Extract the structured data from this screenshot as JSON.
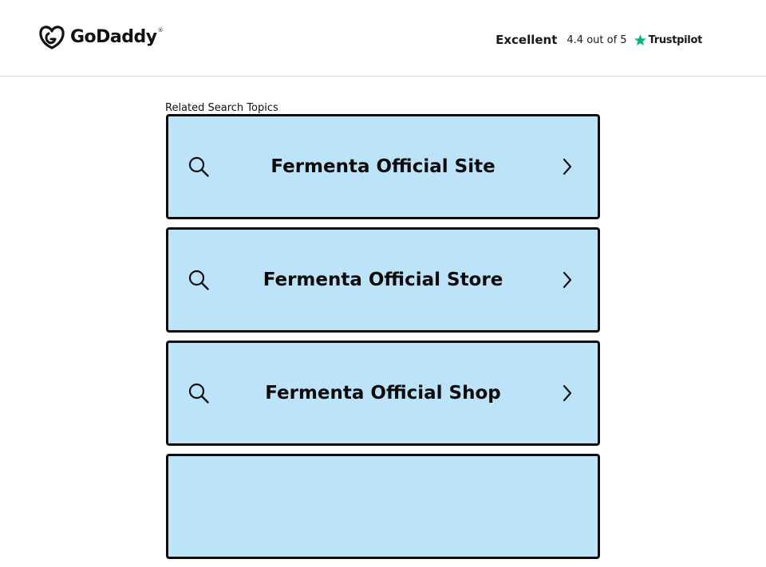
{
  "header": {
    "brand": "GoDaddy",
    "brand_mark": "godaddy-logo-icon",
    "trademark": "®",
    "rating_word": "Excellent",
    "rating_score": "4.4 out of 5",
    "rating_star_icon": "star-icon",
    "rating_provider": "Trustpilot",
    "rating_star_color": "#00b67a"
  },
  "main": {
    "section_label": "Related Search Topics",
    "card_color": "#bde3f9",
    "topics": [
      {
        "label": "Fermenta Official Site",
        "icon": "search-icon",
        "arrow": "chevron-right-icon"
      },
      {
        "label": "Fermenta Official Store",
        "icon": "search-icon",
        "arrow": "chevron-right-icon"
      },
      {
        "label": "Fermenta Official Shop",
        "icon": "search-icon",
        "arrow": "chevron-right-icon"
      }
    ]
  }
}
